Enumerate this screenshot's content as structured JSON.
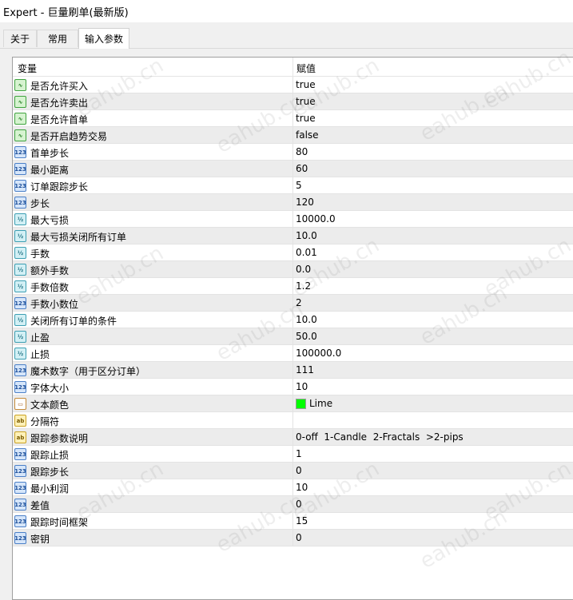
{
  "window": {
    "title": "Expert - 巨量刷单(最新版)"
  },
  "tabs": [
    {
      "label": "关于"
    },
    {
      "label": "常用"
    },
    {
      "label": "输入参数"
    }
  ],
  "grid": {
    "col_name": "变量",
    "col_value": "赋值",
    "rows": [
      {
        "icon": "bool",
        "name": "是否允许买入",
        "value": "true"
      },
      {
        "icon": "bool",
        "name": "是否允许卖出",
        "value": "true"
      },
      {
        "icon": "bool",
        "name": "是否允许首单",
        "value": "true"
      },
      {
        "icon": "bool",
        "name": "是否开启趋势交易",
        "value": "false"
      },
      {
        "icon": "int",
        "name": "首单步长",
        "value": "80"
      },
      {
        "icon": "int",
        "name": "最小距离",
        "value": "60"
      },
      {
        "icon": "int",
        "name": "订单跟踪步长",
        "value": "5"
      },
      {
        "icon": "int",
        "name": "步长",
        "value": "120"
      },
      {
        "icon": "dbl",
        "name": "最大亏损",
        "value": "10000.0"
      },
      {
        "icon": "dbl",
        "name": "最大亏损关闭所有订单",
        "value": "10.0"
      },
      {
        "icon": "dbl",
        "name": "手数",
        "value": "0.01"
      },
      {
        "icon": "dbl",
        "name": "额外手数",
        "value": "0.0"
      },
      {
        "icon": "dbl",
        "name": "手数倍数",
        "value": "1.2"
      },
      {
        "icon": "int",
        "name": "手数小数位",
        "value": "2"
      },
      {
        "icon": "dbl",
        "name": "关闭所有订单的条件",
        "value": "10.0"
      },
      {
        "icon": "dbl",
        "name": "止盈",
        "value": "50.0"
      },
      {
        "icon": "dbl",
        "name": "止损",
        "value": "100000.0"
      },
      {
        "icon": "int",
        "name": "魔术数字（用于区分订单）",
        "value": "111"
      },
      {
        "icon": "int",
        "name": "字体大小",
        "value": "10"
      },
      {
        "icon": "clr",
        "name": "文本颜色",
        "value": "Lime",
        "swatch": "#00ff00"
      },
      {
        "icon": "str",
        "name": "分隔符",
        "value": ""
      },
      {
        "icon": "str",
        "name": "跟踪参数说明",
        "value": "0-off  1-Candle  2-Fractals  >2-pips"
      },
      {
        "icon": "int",
        "name": "跟踪止损",
        "value": "1"
      },
      {
        "icon": "int",
        "name": "跟踪步长",
        "value": "0"
      },
      {
        "icon": "int",
        "name": "最小利润",
        "value": "10"
      },
      {
        "icon": "int",
        "name": "差值",
        "value": "0"
      },
      {
        "icon": "int",
        "name": "跟踪时间框架",
        "value": "15"
      },
      {
        "icon": "int",
        "name": "密钥",
        "value": "0"
      }
    ]
  },
  "icons": {
    "bool": {
      "name": "bool-param-icon",
      "glyph": "∿"
    },
    "int": {
      "name": "int-param-icon",
      "glyph": "123"
    },
    "dbl": {
      "name": "double-param-icon",
      "glyph": "½"
    },
    "str": {
      "name": "string-param-icon",
      "glyph": "ab"
    },
    "clr": {
      "name": "color-param-icon",
      "glyph": "▭"
    }
  },
  "watermark": {
    "text": "eahub.cn"
  }
}
